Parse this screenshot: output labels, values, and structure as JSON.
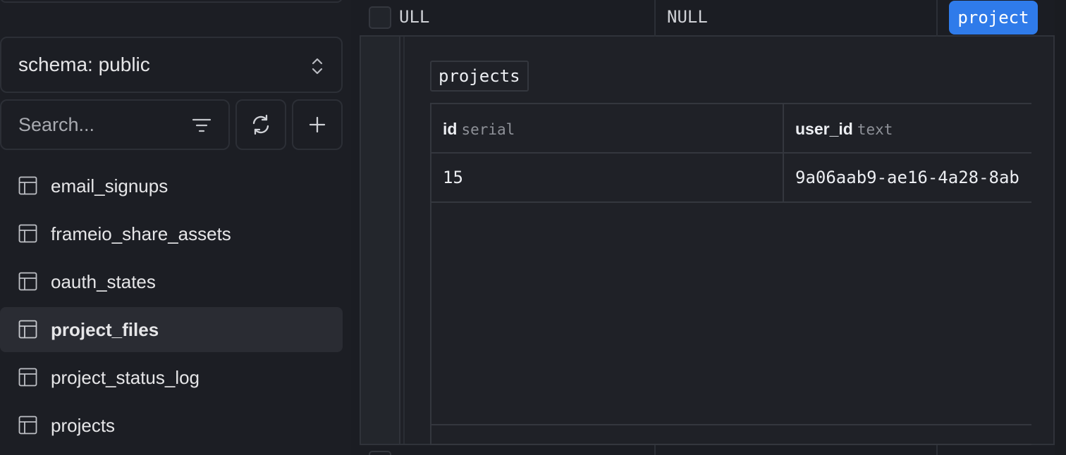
{
  "sidebar": {
    "schema_label": "schema: public",
    "search": {
      "placeholder": "Search..."
    },
    "tables": [
      {
        "name": "email_signups",
        "active": false
      },
      {
        "name": "frameio_share_assets",
        "active": false
      },
      {
        "name": "oauth_states",
        "active": false
      },
      {
        "name": "project_files",
        "active": true
      },
      {
        "name": "project_status_log",
        "active": false
      },
      {
        "name": "projects",
        "active": false
      }
    ]
  },
  "grid": {
    "row_cells": [
      "ULL",
      "NULL"
    ],
    "badge_label": "project"
  },
  "relation": {
    "table_name": "projects",
    "columns": [
      {
        "name": "id",
        "type": "serial"
      },
      {
        "name": "user_id",
        "type": "text"
      }
    ],
    "rows": [
      [
        "15",
        "9a06aab9-ae16-4a28-8ab"
      ]
    ]
  },
  "colors": {
    "accent": "#2f7bea",
    "background": "#1b1d23",
    "active_item": "#2a2c33"
  }
}
